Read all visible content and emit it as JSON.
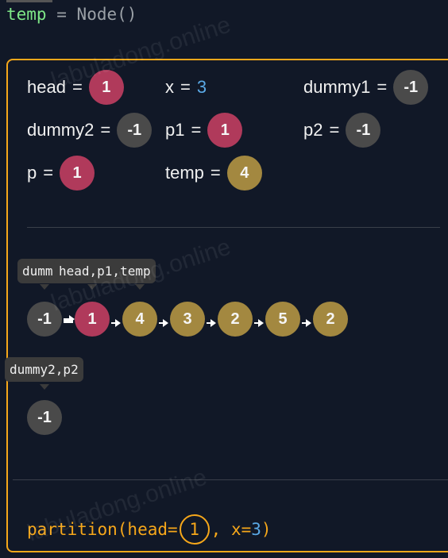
{
  "code_top": {
    "var": "temp",
    "eq": "=",
    "rhs": "Node()"
  },
  "vars": [
    {
      "name": "head",
      "kind": "node",
      "value": "1",
      "color": "red"
    },
    {
      "name": "x",
      "kind": "number",
      "value": "3"
    },
    {
      "name": "dummy1",
      "kind": "node",
      "value": "-1",
      "color": "gray"
    },
    {
      "name": "dummy2",
      "kind": "node",
      "value": "-1",
      "color": "gray"
    },
    {
      "name": "p1",
      "kind": "node",
      "value": "1",
      "color": "red"
    },
    {
      "name": "p2",
      "kind": "node",
      "value": "-1",
      "color": "gray"
    },
    {
      "name": "p",
      "kind": "node",
      "value": "1",
      "color": "red"
    },
    {
      "name": "temp",
      "kind": "node",
      "value": "4",
      "color": "gold"
    }
  ],
  "list1": {
    "tooltips": [
      "dumm",
      "head,p1,temp"
    ],
    "nodes": [
      {
        "value": "-1",
        "color": "gray"
      },
      {
        "value": "1",
        "color": "red"
      },
      {
        "value": "4",
        "color": "gold"
      },
      {
        "value": "3",
        "color": "gold"
      },
      {
        "value": "2",
        "color": "gold"
      },
      {
        "value": "5",
        "color": "gold"
      },
      {
        "value": "2",
        "color": "gold"
      }
    ]
  },
  "list2": {
    "tooltip": "dummy2,p2",
    "nodes": [
      {
        "value": "-1",
        "color": "gray"
      }
    ]
  },
  "call": {
    "func": "partition(head=",
    "arg": "1",
    "sep": ",  x=",
    "x": "3",
    "close": ")"
  },
  "watermark": "labuladong.online",
  "colors": {
    "accent": "#f6a71a",
    "red": "#b03a5b",
    "gold": "#a38840",
    "gray": "#4a4a4a",
    "number": "#5aa9e6"
  }
}
